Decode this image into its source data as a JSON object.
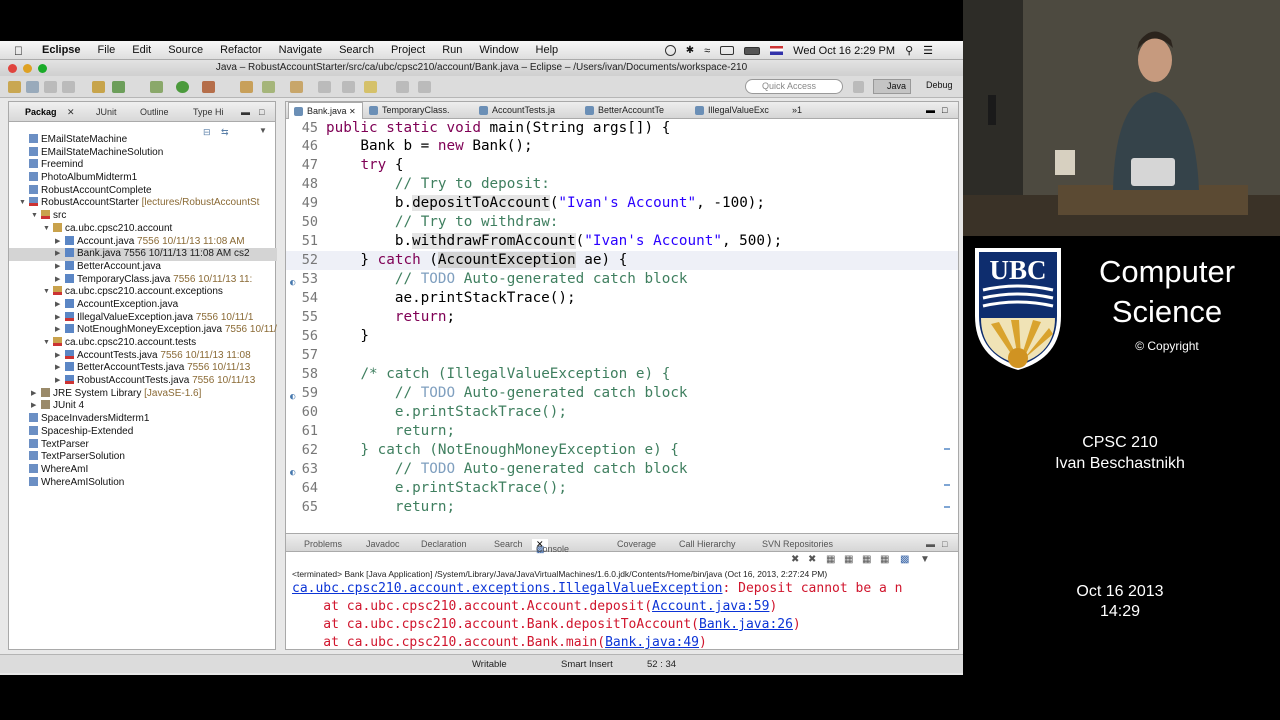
{
  "menubar": {
    "app": "Eclipse",
    "items": [
      "File",
      "Edit",
      "Source",
      "Refactor",
      "Navigate",
      "Search",
      "Project",
      "Run",
      "Window",
      "Help"
    ],
    "clock": "Wed Oct 16  2:29 PM"
  },
  "window_title": "Java – RobustAccountStarter/src/ca/ubc/cpsc210/account/Bank.java – Eclipse – /Users/ivan/Documents/workspace-210",
  "toolbar": {
    "quick_access_placeholder": "Quick Access",
    "perspective_java": "Java",
    "perspective_debug": "Debug"
  },
  "package_explorer": {
    "tabs": [
      "Packag",
      "JUnit",
      "Outline",
      "Type Hi"
    ],
    "tree": [
      {
        "label": "EMailStateMachine",
        "meta": ""
      },
      {
        "label": "EMailStateMachineSolution",
        "meta": ""
      },
      {
        "label": "Freemind",
        "meta": ""
      },
      {
        "label": "PhotoAlbumMidterm1",
        "meta": ""
      },
      {
        "label": "RobustAccountComplete",
        "meta": ""
      },
      {
        "label": "RobustAccountStarter",
        "meta": "[lectures/RobustAccountSt"
      },
      {
        "label": "src",
        "meta": ""
      },
      {
        "label": "ca.ubc.cpsc210.account",
        "meta": ""
      },
      {
        "label": "Account.java",
        "meta": "7556  10/11/13 11:08 AM"
      },
      {
        "label": "Bank.java",
        "meta": "7556  10/11/13 11:08 AM  cs2"
      },
      {
        "label": "BetterAccount.java",
        "meta": ""
      },
      {
        "label": "TemporaryClass.java",
        "meta": "7556  10/11/13 11:"
      },
      {
        "label": "ca.ubc.cpsc210.account.exceptions",
        "meta": ""
      },
      {
        "label": "AccountException.java",
        "meta": ""
      },
      {
        "label": "IllegalValueException.java",
        "meta": "7556  10/11/1"
      },
      {
        "label": "NotEnoughMoneyException.java",
        "meta": "7556  10/11/"
      },
      {
        "label": "ca.ubc.cpsc210.account.tests",
        "meta": ""
      },
      {
        "label": "AccountTests.java",
        "meta": "7556  10/11/13 11:08"
      },
      {
        "label": "BetterAccountTests.java",
        "meta": "7556  10/11/13"
      },
      {
        "label": "RobustAccountTests.java",
        "meta": "7556  10/11/13"
      },
      {
        "label": "JRE System Library",
        "meta": "[JavaSE-1.6]"
      },
      {
        "label": "JUnit 4",
        "meta": ""
      },
      {
        "label": "SpaceInvadersMidterm1",
        "meta": ""
      },
      {
        "label": "Spaceship-Extended",
        "meta": ""
      },
      {
        "label": "TextParser",
        "meta": ""
      },
      {
        "label": "TextParserSolution",
        "meta": ""
      },
      {
        "label": "WhereAmI",
        "meta": ""
      },
      {
        "label": "WhereAmISolution",
        "meta": ""
      }
    ]
  },
  "editor": {
    "tabs": [
      "Bank.java",
      "TemporaryClass.",
      "AccountTests.ja",
      "BetterAccountTe",
      "IllegalValueExc",
      "»1"
    ],
    "line_numbers": [
      "45",
      "46",
      "47",
      "48",
      "49",
      "50",
      "51",
      "52",
      "53",
      "54",
      "55",
      "56",
      "57",
      "58",
      "59",
      "60",
      "61",
      "62",
      "63",
      "64",
      "65"
    ]
  },
  "console": {
    "tabs": [
      "Problems",
      "Javadoc",
      "Declaration",
      "Search",
      "Console",
      "Coverage",
      "Call Hierarchy",
      "SVN Repositories"
    ],
    "terminated": "<terminated> Bank [Java Application] /System/Library/Java/JavaVirtualMachines/1.6.0.jdk/Contents/Home/bin/java (Oct 16, 2013, 2:27:24 PM)",
    "exception_class": "ca.ubc.cpsc210.account.exceptions.IllegalValueException",
    "exception_msg": ": Deposit cannot be a n",
    "frame1_prefix": "    at ca.ubc.cpsc210.account.Account.deposit(",
    "frame1_link": "Account.java:59",
    "frame2_prefix": "    at ca.ubc.cpsc210.account.Bank.depositToAccount(",
    "frame2_link": "Bank.java:26",
    "frame3_prefix": "    at ca.ubc.cpsc210.account.Bank.main(",
    "frame3_link": "Bank.java:49"
  },
  "statusbar": {
    "writable": "Writable",
    "insert_mode": "Smart Insert",
    "position": "52 : 34"
  },
  "side_panel": {
    "dept_line1": "Computer",
    "dept_line2": "Science",
    "copyright": "© Copyright",
    "course": "CPSC 210",
    "instructor": "Ivan Beschastnikh",
    "date": "Oct 16 2013",
    "time": "14:29"
  }
}
